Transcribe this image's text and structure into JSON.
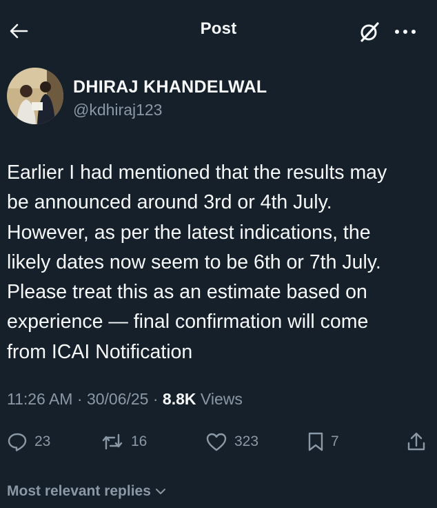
{
  "header": {
    "title": "Post"
  },
  "author": {
    "name": "DHIRAJ KHANDELWAL",
    "handle": "@kdhiraj123"
  },
  "post": {
    "lines": [
      "Earlier I had mentioned that the results may",
      "be announced around 3rd or 4th July.",
      "However, as per the latest indications, the",
      "likely dates now seem to be 6th or 7th July.",
      "Please treat this as an estimate based on",
      "experience — final confirmation will come",
      "from ICAI Notification"
    ]
  },
  "meta": {
    "time": "11:26 AM",
    "separator": " · ",
    "date": "30/06/25",
    "views_count": "8.8K",
    "views_label": " Views"
  },
  "actions": {
    "replies": "23",
    "reposts": "16",
    "likes": "323",
    "bookmarks": "7"
  },
  "replies_sort": {
    "label": "Most relevant replies"
  },
  "colors": {
    "background": "#15202b",
    "text": "#f7f9f9",
    "secondary": "#8b98a5"
  },
  "icons": [
    "back-arrow-icon",
    "grok-icon",
    "more-icon",
    "reply-icon",
    "repost-icon",
    "like-icon",
    "bookmark-icon",
    "share-icon",
    "chevron-down-icon"
  ]
}
